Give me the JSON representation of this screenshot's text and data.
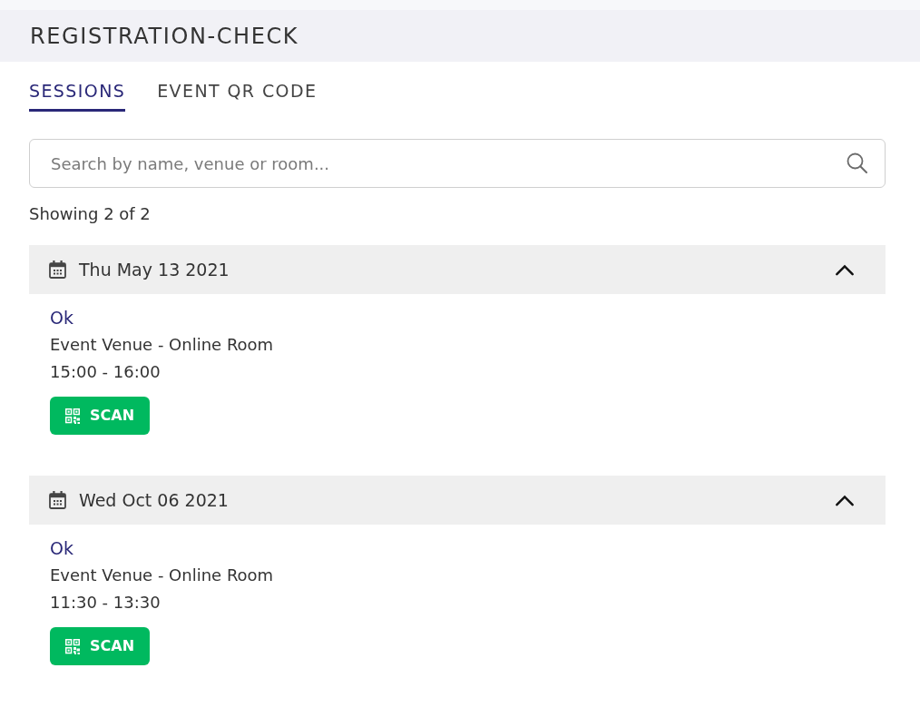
{
  "header": {
    "title": "REGISTRATION-CHECK"
  },
  "tabs": [
    {
      "label": "SESSIONS",
      "selected": true
    },
    {
      "label": "EVENT QR CODE",
      "selected": false
    }
  ],
  "search": {
    "placeholder": "Search by name, venue or room..."
  },
  "result_count": "Showing 2 of 2",
  "date_groups": [
    {
      "date": "Thu May 13 2021",
      "expanded": true,
      "sessions": [
        {
          "name": "Ok",
          "location": "Event Venue - Online Room",
          "time": "15:00 - 16:00",
          "action": "SCAN"
        }
      ]
    },
    {
      "date": "Wed Oct 06 2021",
      "expanded": true,
      "sessions": [
        {
          "name": "Ok",
          "location": "Event Venue - Online Room",
          "time": "11:30 - 13:30",
          "action": "SCAN"
        }
      ]
    }
  ]
}
